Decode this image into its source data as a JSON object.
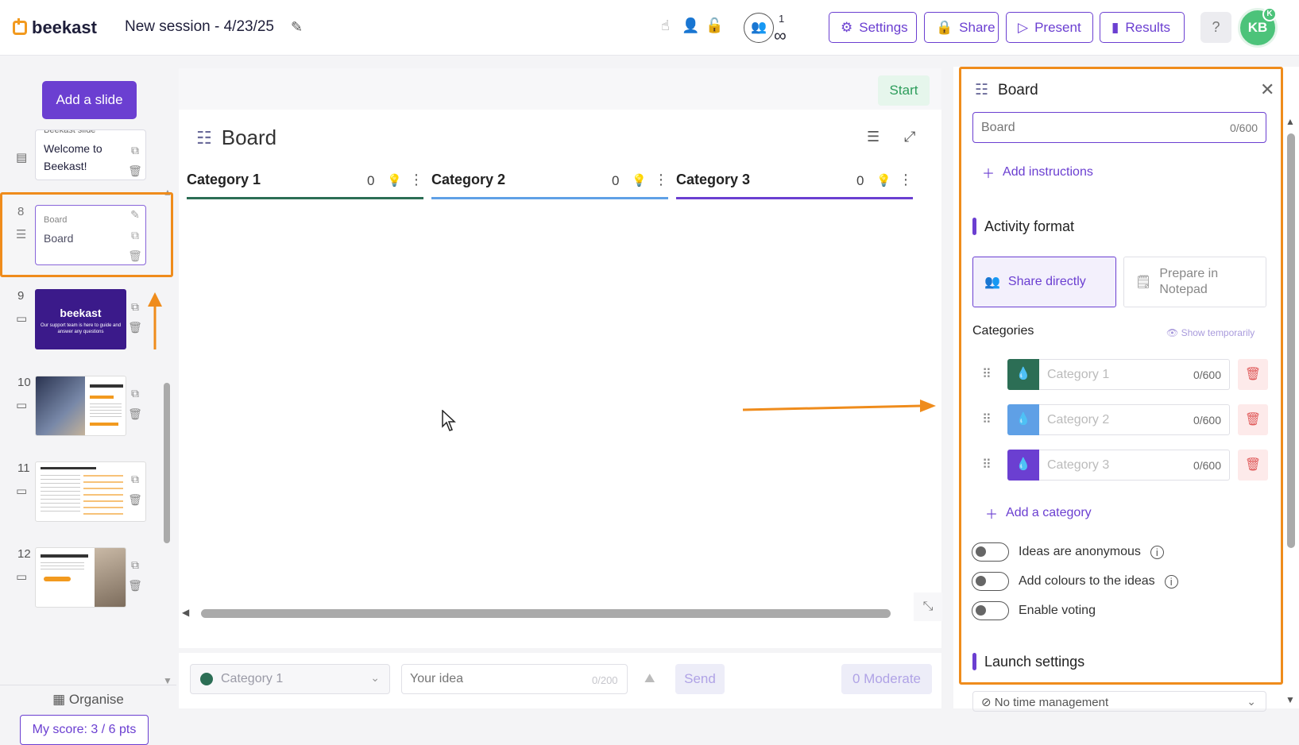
{
  "app": {
    "logo_text": "beekast",
    "session_title": "New session - 4/23/25",
    "participants_count": "1",
    "participants_limit": "∞",
    "buttons": {
      "settings": "Settings",
      "share": "Share",
      "present": "Present",
      "results": "Results"
    },
    "help": "?",
    "avatar": "KB",
    "avatar_badge": "K"
  },
  "sidebar": {
    "add_slide": "Add a slide",
    "slides": [
      {
        "num": "",
        "kind": "Beekast slide",
        "title": "Welcome to Beekast!"
      },
      {
        "num": "8",
        "kind": "Board",
        "title": "Board",
        "selected": true
      },
      {
        "num": "9",
        "thumb": "beekast",
        "thumb_caption": "Our support team is here to guide and answer any questions"
      },
      {
        "num": "10",
        "thumb": "photo-text"
      },
      {
        "num": "11",
        "thumb": "text-grid"
      },
      {
        "num": "12",
        "thumb": "portrait"
      }
    ],
    "organise": "Organise",
    "score": "My score: 3 / 6 pts"
  },
  "canvas": {
    "start": "Start",
    "board_title": "Board",
    "columns": [
      {
        "name": "Category 1",
        "count": "0",
        "color": "#2c6e55"
      },
      {
        "name": "Category 2",
        "count": "0",
        "color": "#5fa0e6"
      },
      {
        "name": "Category 3",
        "count": "0",
        "color": "#6b3fd1"
      }
    ]
  },
  "input_bar": {
    "category": "Category 1",
    "placeholder": "Your idea",
    "counter": "0/200",
    "send": "Send",
    "moderate": "0 Moderate"
  },
  "panel": {
    "title": "Board",
    "name_placeholder": "Board",
    "name_counter": "0/600",
    "add_instructions": "Add instructions",
    "activity_format": "Activity format",
    "share_directly": "Share directly",
    "prepare_notepad": "Prepare in Notepad",
    "categories_label": "Categories",
    "show_temporarily": "Show temporarily",
    "categories": [
      {
        "placeholder": "Category 1",
        "counter": "0/600",
        "color": "#2c6e55"
      },
      {
        "placeholder": "Category 2",
        "counter": "0/600",
        "color": "#5fa0e6"
      },
      {
        "placeholder": "Category 3",
        "counter": "0/600",
        "color": "#6b3fd1"
      }
    ],
    "add_category": "Add a category",
    "toggles": {
      "anonymous": "Ideas are anonymous",
      "colours": "Add colours to the ideas",
      "voting": "Enable voting"
    },
    "launch_settings": "Launch settings",
    "time_management": "No time management"
  },
  "colors": {
    "accent": "#6b3fd1",
    "annotation": "#ef8c1c",
    "start": "#2d9c5b"
  }
}
